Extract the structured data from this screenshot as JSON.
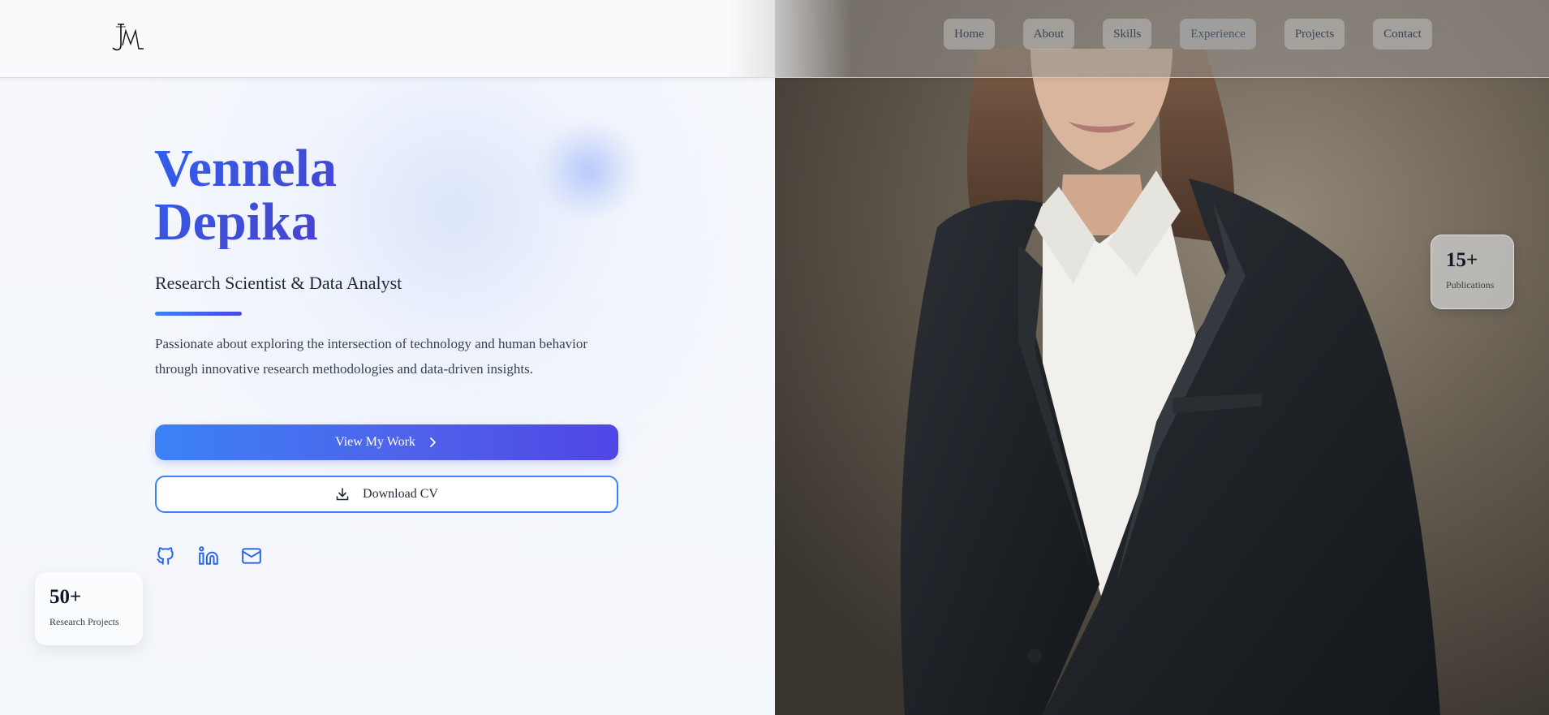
{
  "header": {
    "logo_text": "JM",
    "nav": [
      {
        "label": "Home"
      },
      {
        "label": "About"
      },
      {
        "label": "Skills"
      },
      {
        "label": "Experience"
      },
      {
        "label": "Projects"
      },
      {
        "label": "Contact"
      }
    ]
  },
  "hero": {
    "first_name": "Vennela",
    "last_name": "Depika",
    "role": "Research Scientist & Data Analyst",
    "description": "Passionate about exploring the intersection of technology and human behavior through innovative research methodologies and data-driven insights.",
    "primary_button": "View My Work",
    "secondary_button": "Download CV",
    "socials": [
      "github-icon",
      "linkedin-icon",
      "mail-icon"
    ]
  },
  "stats": {
    "projects": {
      "value": "50+",
      "label": "Research Projects"
    },
    "publications": {
      "value": "15+",
      "label": "Publications"
    }
  },
  "colors": {
    "accent_start": "#3b82f6",
    "accent_end": "#4f46e5",
    "text_dark": "#1f2937"
  }
}
